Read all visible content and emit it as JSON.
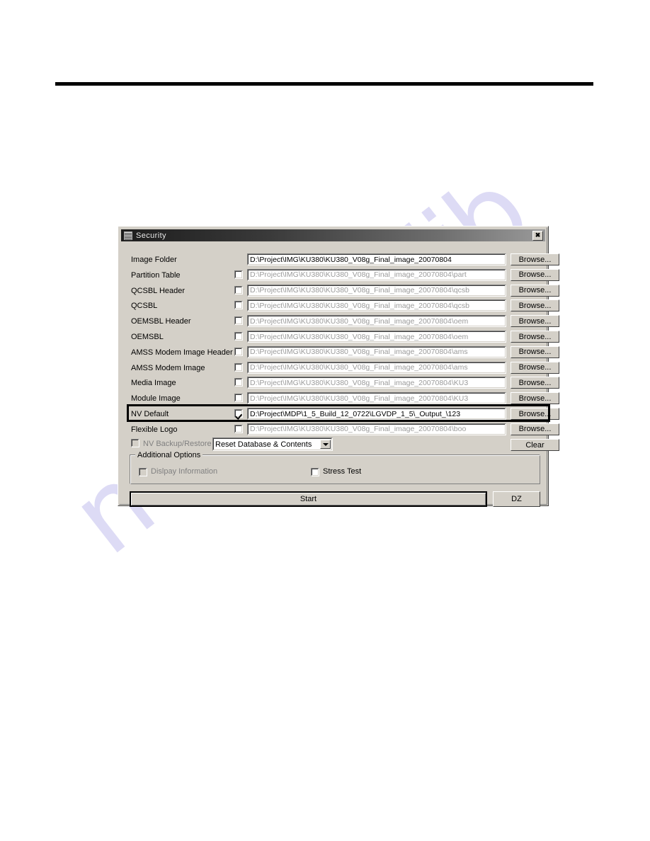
{
  "page": {
    "watermark_text": "manualslib",
    "watermark_color": "#c9c6ef",
    "rule_color": "#000000"
  },
  "dialog": {
    "title": "Security",
    "close_label": "✕",
    "icon": "app-icon",
    "background_color": "#d4d0c8",
    "titlebar_color": "#1d1d1d",
    "browse_label": "Browse...",
    "clear_label": "Clear",
    "start_label": "Start",
    "dz_label": "DZ",
    "highlight_color": "#000000",
    "rows": [
      {
        "label": "Image Folder",
        "has_checkbox": false,
        "checked": false,
        "path": "D:\\Project\\IMG\\KU380\\KU380_V08g_Final_image_20070804",
        "enabled": true,
        "browse": "Browse...",
        "highlighted": false
      },
      {
        "label": "Partition Table",
        "has_checkbox": true,
        "checked": false,
        "path": "D:\\Project\\IMG\\KU380\\KU380_V08g_Final_image_20070804\\part",
        "enabled": false,
        "browse": "Browse...",
        "highlighted": false
      },
      {
        "label": "QCSBL Header",
        "has_checkbox": true,
        "checked": false,
        "path": "D:\\Project\\IMG\\KU380\\KU380_V08g_Final_image_20070804\\qcsb",
        "enabled": false,
        "browse": "Browse...",
        "highlighted": false
      },
      {
        "label": "QCSBL",
        "has_checkbox": true,
        "checked": false,
        "path": "D:\\Project\\IMG\\KU380\\KU380_V08g_Final_image_20070804\\qcsb",
        "enabled": false,
        "browse": "Browse...",
        "highlighted": false
      },
      {
        "label": "OEMSBL Header",
        "has_checkbox": true,
        "checked": false,
        "path": "D:\\Project\\IMG\\KU380\\KU380_V08g_Final_image_20070804\\oem",
        "enabled": false,
        "browse": "Browse...",
        "highlighted": false
      },
      {
        "label": "OEMSBL",
        "has_checkbox": true,
        "checked": false,
        "path": "D:\\Project\\IMG\\KU380\\KU380_V08g_Final_image_20070804\\oem",
        "enabled": false,
        "browse": "Browse...",
        "highlighted": false
      },
      {
        "label": "AMSS Modem Image Header",
        "has_checkbox": true,
        "checked": false,
        "path": "D:\\Project\\IMG\\KU380\\KU380_V08g_Final_image_20070804\\ams",
        "enabled": false,
        "browse": "Browse...",
        "highlighted": false
      },
      {
        "label": "AMSS Modem Image",
        "has_checkbox": true,
        "checked": false,
        "path": "D:\\Project\\IMG\\KU380\\KU380_V08g_Final_image_20070804\\ams",
        "enabled": false,
        "browse": "Browse...",
        "highlighted": false
      },
      {
        "label": "Media Image",
        "has_checkbox": true,
        "checked": false,
        "path": "D:\\Project\\IMG\\KU380\\KU380_V08g_Final_image_20070804\\KU3",
        "enabled": false,
        "browse": "Browse...",
        "highlighted": false
      },
      {
        "label": "Module Image",
        "has_checkbox": true,
        "checked": false,
        "path": "D:\\Project\\IMG\\KU380\\KU380_V08g_Final_image_20070804\\KU3",
        "enabled": false,
        "browse": "Browse...",
        "highlighted": false
      },
      {
        "label": "NV Default",
        "has_checkbox": true,
        "checked": true,
        "path": "D:\\Project\\MDP\\1_5_Build_12_0722\\LGVDP_1_5\\_Output_\\123",
        "enabled": true,
        "browse": "Browse...",
        "highlighted": true
      },
      {
        "label": "Flexible Logo",
        "has_checkbox": true,
        "checked": false,
        "path": "D:\\Project\\IMG\\KU380\\KU380_V08g_Final_image_20070804\\boo",
        "enabled": false,
        "browse": "Browse...",
        "highlighted": false
      }
    ],
    "nv_backup": {
      "label": "NV Backup/Restore",
      "checked": false,
      "enabled": false
    },
    "mode_select": {
      "value": "Reset Database & Contents",
      "options": [
        "Reset Database & Contents"
      ]
    },
    "additional_options": {
      "title": "Additional Options",
      "display_information": {
        "label": "Dislpay Information",
        "checked": false,
        "enabled": false
      },
      "stress_test": {
        "label": "Stress Test",
        "checked": false,
        "enabled": true
      }
    }
  }
}
